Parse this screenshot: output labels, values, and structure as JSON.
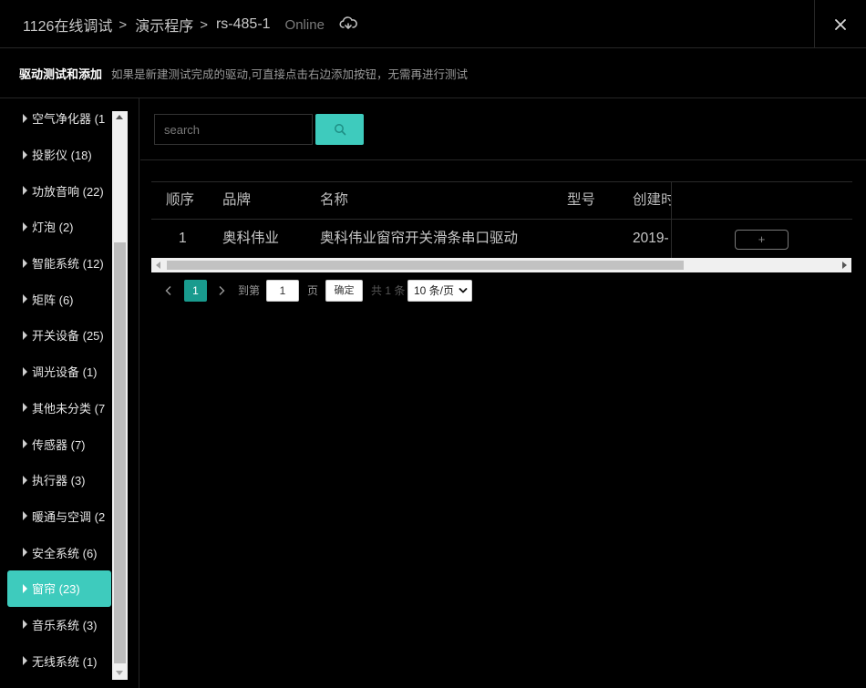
{
  "header": {
    "breadcrumb": [
      "1126在线调试",
      "演示程序",
      "rs-485-1"
    ],
    "status": "Online",
    "cloud_icon": "cloud-sync-icon",
    "close_icon": "close-icon"
  },
  "subheader": {
    "title": "驱动测试和添加",
    "hint": "如果是新建测试完成的驱动,可直接点击右边添加按钮，无需再进行测试"
  },
  "sidebar": {
    "items": [
      {
        "label": "空气净化器 (1"
      },
      {
        "label": "投影仪 (18)"
      },
      {
        "label": "功放音响 (22)"
      },
      {
        "label": "灯泡 (2)"
      },
      {
        "label": "智能系统 (12)"
      },
      {
        "label": "矩阵 (6)"
      },
      {
        "label": "开关设备 (25)"
      },
      {
        "label": "调光设备 (1)"
      },
      {
        "label": "其他未分类 (7"
      },
      {
        "label": "传感器 (7)"
      },
      {
        "label": "执行器 (3)"
      },
      {
        "label": "暖通与空调 (2"
      },
      {
        "label": "安全系统 (6)"
      },
      {
        "label": "窗帘 (23)",
        "active": true
      },
      {
        "label": "音乐系统 (3)"
      },
      {
        "label": "无线系统 (1)"
      }
    ]
  },
  "search": {
    "placeholder": "search",
    "value": "",
    "button_icon": "search-icon"
  },
  "table": {
    "columns": [
      "顺序",
      "品牌",
      "名称",
      "型号",
      "创建时"
    ],
    "rows": [
      {
        "index": "1",
        "brand": "奥科伟业",
        "name": "奥科伟业窗帘开关滑条串口驱动",
        "model": "",
        "created": "2019-",
        "action": "+"
      }
    ]
  },
  "pager": {
    "current": "1",
    "goto_label": "到第",
    "goto_value": "1",
    "page_label": "页",
    "confirm_label": "确定",
    "total": "共 1 条",
    "page_size": "10 条/页"
  },
  "colors": {
    "accent": "#3ecbbd",
    "pager_active": "#199b8e",
    "background": "#000000"
  }
}
